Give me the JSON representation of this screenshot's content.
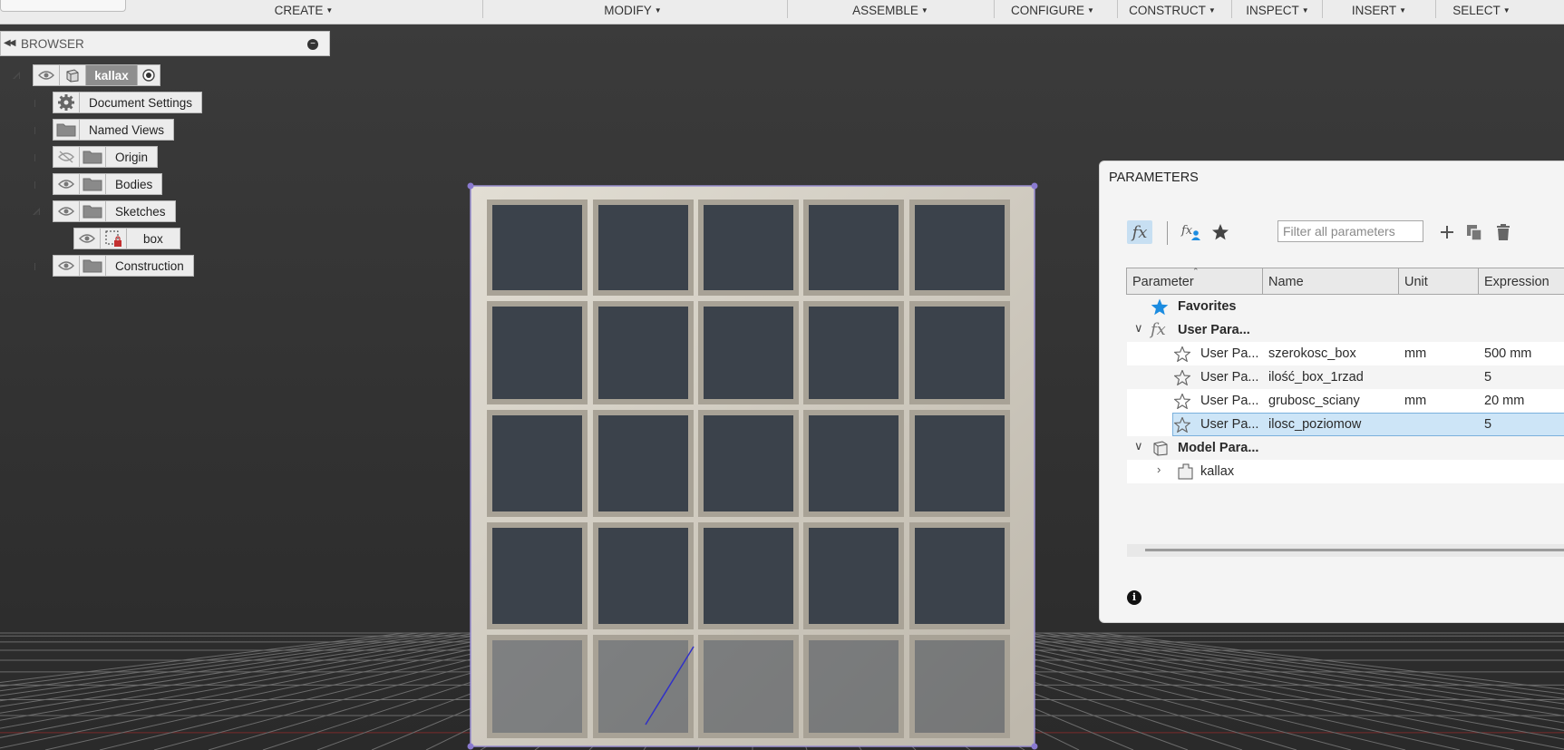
{
  "toolbar": {
    "create": "CREATE",
    "modify": "MODIFY",
    "assemble": "ASSEMBLE",
    "configure": "CONFIGURE",
    "construct": "CONSTRUCT",
    "inspect": "INSPECT",
    "insert": "INSERT",
    "select": "SELECT",
    "caret": "▼"
  },
  "browser": {
    "title": "BROWSER",
    "root": "kallax",
    "items": {
      "document_settings": "Document Settings",
      "named_views": "Named Views",
      "origin": "Origin",
      "bodies": "Bodies",
      "sketches": "Sketches",
      "box": "box",
      "construction": "Construction"
    }
  },
  "parameters": {
    "title": "PARAMETERS",
    "filter_placeholder": "Filter all parameters",
    "columns": [
      "Parameter",
      "Name",
      "Unit",
      "Expression"
    ],
    "favorites_label": "Favorites",
    "user_group_label": "User Para...",
    "rows": [
      {
        "param": "User Pa...",
        "name": "szerokosc_box",
        "unit": "mm",
        "expression": "500 mm"
      },
      {
        "param": "User Pa...",
        "name": "ilość_box_1rzad",
        "unit": "",
        "expression": "5"
      },
      {
        "param": "User Pa...",
        "name": "grubosc_sciany",
        "unit": "mm",
        "expression": "20 mm"
      },
      {
        "param": "User Pa...",
        "name": "ilosc_poziomow",
        "unit": "",
        "expression": "5"
      }
    ],
    "model_group_label": "Model Para...",
    "model_item": "kallax",
    "accent_color": "#1c8ce0",
    "selected_row_color": "#cde5f7"
  },
  "icons": {
    "fx": "fx-icon",
    "user_fx": "user-fx-icon",
    "star": "star-icon",
    "add": "plus-icon",
    "copy": "copy-icon",
    "delete": "trash-icon",
    "info": "info-icon"
  }
}
